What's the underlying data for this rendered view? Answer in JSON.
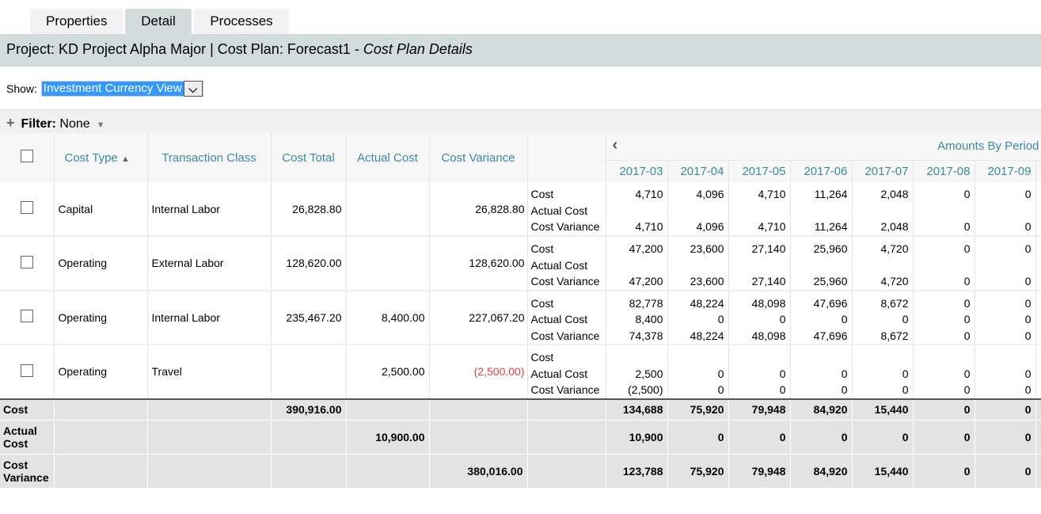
{
  "tabs": [
    {
      "label": "Properties"
    },
    {
      "label": "Detail",
      "active": true
    },
    {
      "label": "Processes"
    }
  ],
  "header": {
    "title": "Project: KD Project Alpha Major | Cost Plan: Forecast1 - ",
    "subtitle": "Cost Plan Details"
  },
  "show": {
    "label": "Show:",
    "value": "Investment Currency View"
  },
  "filter": {
    "label": "Filter:",
    "value": "None"
  },
  "columns": {
    "cost_type": "Cost Type",
    "transaction_class": "Transaction Class",
    "cost_total": "Cost Total",
    "actual_cost": "Actual Cost",
    "cost_variance": "Cost Variance",
    "amounts_by_period": "Amounts By Period"
  },
  "periods": [
    "2017-03",
    "2017-04",
    "2017-05",
    "2017-06",
    "2017-07",
    "2017-08",
    "2017-09"
  ],
  "metric_labels": [
    "Cost",
    "Actual Cost",
    "Cost Variance"
  ],
  "rows": [
    {
      "cost_type": "Capital",
      "transaction_class": "Internal Labor",
      "cost_total": "26,828.80",
      "actual_cost": "",
      "cost_variance": "26,828.80",
      "cost": [
        "4,710",
        "4,096",
        "4,710",
        "11,264",
        "2,048",
        "0",
        "0"
      ],
      "actual": [
        "",
        "",
        "",
        "",
        "",
        "",
        ""
      ],
      "variance": [
        "4,710",
        "4,096",
        "4,710",
        "11,264",
        "2,048",
        "0",
        "0"
      ]
    },
    {
      "cost_type": "Operating",
      "transaction_class": "External Labor",
      "cost_total": "128,620.00",
      "actual_cost": "",
      "cost_variance": "128,620.00",
      "cost": [
        "47,200",
        "23,600",
        "27,140",
        "25,960",
        "4,720",
        "0",
        "0"
      ],
      "actual": [
        "",
        "",
        "",
        "",
        "",
        "",
        ""
      ],
      "variance": [
        "47,200",
        "23,600",
        "27,140",
        "25,960",
        "4,720",
        "0",
        "0"
      ]
    },
    {
      "cost_type": "Operating",
      "transaction_class": "Internal Labor",
      "cost_total": "235,467.20",
      "actual_cost": "8,400.00",
      "cost_variance": "227,067.20",
      "cost": [
        "82,778",
        "48,224",
        "48,098",
        "47,696",
        "8,672",
        "0",
        "0"
      ],
      "actual": [
        "8,400",
        "0",
        "0",
        "0",
        "0",
        "0",
        "0"
      ],
      "variance": [
        "74,378",
        "48,224",
        "48,098",
        "47,696",
        "8,672",
        "0",
        "0"
      ]
    },
    {
      "cost_type": "Operating",
      "transaction_class": "Travel",
      "cost_total": "",
      "actual_cost": "2,500.00",
      "cost_variance": "(2,500.00)",
      "negative": true,
      "cost": [
        "",
        "",
        "",
        "",
        "",
        "",
        ""
      ],
      "actual": [
        "2,500",
        "0",
        "0",
        "0",
        "0",
        "0",
        "0"
      ],
      "variance": [
        "(2,500)",
        "0",
        "0",
        "0",
        "0",
        "0",
        "0"
      ]
    }
  ],
  "totals": [
    {
      "label": "Cost",
      "cost_total": "390,916.00",
      "actual_cost": "",
      "cost_variance": "",
      "periods": [
        "134,688",
        "75,920",
        "79,948",
        "84,920",
        "15,440",
        "0",
        "0"
      ]
    },
    {
      "label": "Actual Cost",
      "cost_total": "",
      "actual_cost": "10,900.00",
      "cost_variance": "",
      "periods": [
        "10,900",
        "0",
        "0",
        "0",
        "0",
        "0",
        "0"
      ]
    },
    {
      "label": "Cost Variance",
      "cost_total": "",
      "actual_cost": "",
      "cost_variance": "380,016.00",
      "periods": [
        "123,788",
        "75,920",
        "79,948",
        "84,920",
        "15,440",
        "0",
        "0"
      ]
    }
  ]
}
